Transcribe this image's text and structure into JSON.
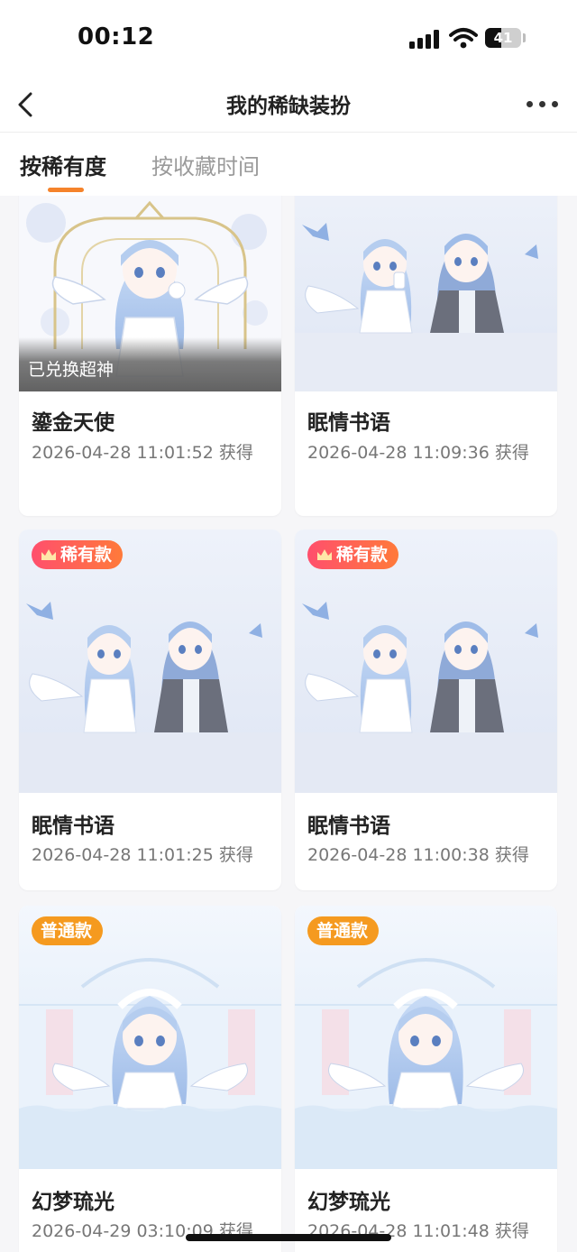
{
  "status_bar": {
    "time": "00:12",
    "battery_level": "41"
  },
  "nav": {
    "title": "我的稀缺装扮"
  },
  "tabs": [
    {
      "label": "按稀有度",
      "active": true
    },
    {
      "label": "按收藏时间",
      "active": false
    }
  ],
  "colors": {
    "accent": "#f5832b",
    "badge_rare": "#ff5a5f",
    "badge_common": "#f59a1f"
  },
  "cards": [
    {
      "title": "鎏金天使",
      "date": "2026-04-28 11:01:52 获得",
      "overlay": "已兑换超神",
      "image": "golden-angel-image"
    },
    {
      "title": "眠情书语",
      "date": "2026-04-28 11:09:36 获得",
      "image": "sleepy-love-letter-image"
    },
    {
      "title": "眠情书语",
      "date": "2026-04-28 11:01:25 获得",
      "badge": "稀有款",
      "image": "sleepy-love-letter-image"
    },
    {
      "title": "眠情书语",
      "date": "2026-04-28 11:00:38 获得",
      "badge": "稀有款",
      "image": "sleepy-love-letter-image"
    },
    {
      "title": "幻梦琉光",
      "date": "2026-04-29 03:10:09 获得",
      "badge": "普通款",
      "image": "dream-glaze-image"
    },
    {
      "title": "幻梦琉光",
      "date": "2026-04-28 11:01:48 获得",
      "badge": "普通款",
      "image": "dream-glaze-image"
    }
  ]
}
